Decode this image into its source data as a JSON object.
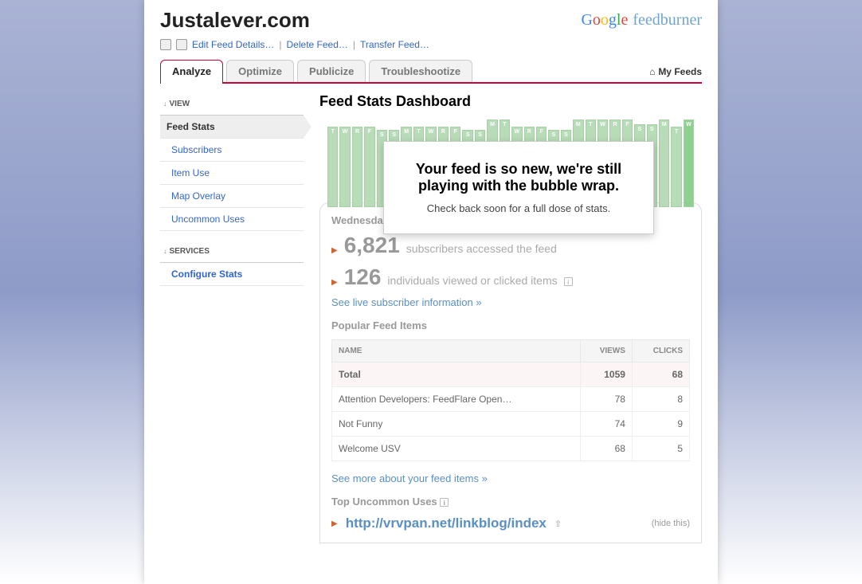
{
  "header": {
    "title": "Justalever.com",
    "brand_fb": "feedburner",
    "edit_link": "Edit Feed Details…",
    "delete_link": "Delete Feed…",
    "transfer_link": "Transfer Feed…"
  },
  "tabs": {
    "analyze": "Analyze",
    "optimize": "Optimize",
    "publicize": "Publicize",
    "troubleshoot": "Troubleshootize",
    "myfeeds": "My Feeds"
  },
  "sidebar": {
    "view_label": "VIEW",
    "feed_stats": "Feed Stats",
    "subscribers": "Subscribers",
    "item_use": "Item Use",
    "map_overlay": "Map Overlay",
    "uncommon": "Uncommon Uses",
    "services_label": "SERVICES",
    "configure": "Configure Stats"
  },
  "main": {
    "title": "Feed Stats Dashboard",
    "popup_title": "Your feed is so new, we're still playing with the bubble wrap.",
    "popup_sub": "Check back soon for a full dose of stats.",
    "date": "Wednesday",
    "subs_num": "6,821",
    "subs_txt": "subscribers accessed the feed",
    "ind_num": "126",
    "ind_txt": "individuals viewed or clicked items",
    "live_link": "See live subscriber information »",
    "popular_title": "Popular Feed Items",
    "th_name": "NAME",
    "th_views": "VIEWS",
    "th_clicks": "CLICKS",
    "total_label": "Total",
    "total_views": "1059",
    "total_clicks": "68",
    "rows": [
      {
        "name": "Attention Developers: FeedFlare Open…",
        "views": "78",
        "clicks": "8"
      },
      {
        "name": "Not Funny",
        "views": "74",
        "clicks": "9"
      },
      {
        "name": "Welcome USV",
        "views": "68",
        "clicks": "5"
      }
    ],
    "more_link": "See more about your feed items »",
    "uncommon_title": "Top Uncommon Uses",
    "uncommon_url": "http://vrvpan.net/linkblog/index",
    "hide_label": "(hide this)"
  },
  "chart_data": {
    "type": "bar",
    "labels": [
      "T",
      "W",
      "R",
      "F",
      "S",
      "S",
      "M",
      "T",
      "W",
      "R",
      "F",
      "S",
      "S",
      "M",
      "T",
      "W",
      "R",
      "F",
      "S",
      "S",
      "M",
      "T",
      "W",
      "R",
      "F",
      "S",
      "S",
      "M",
      "T",
      "W"
    ],
    "values": [
      92,
      92,
      92,
      92,
      88,
      88,
      92,
      92,
      92,
      92,
      92,
      88,
      88,
      100,
      100,
      92,
      92,
      92,
      88,
      88,
      100,
      100,
      100,
      100,
      100,
      95,
      95,
      100,
      92,
      100
    ]
  }
}
